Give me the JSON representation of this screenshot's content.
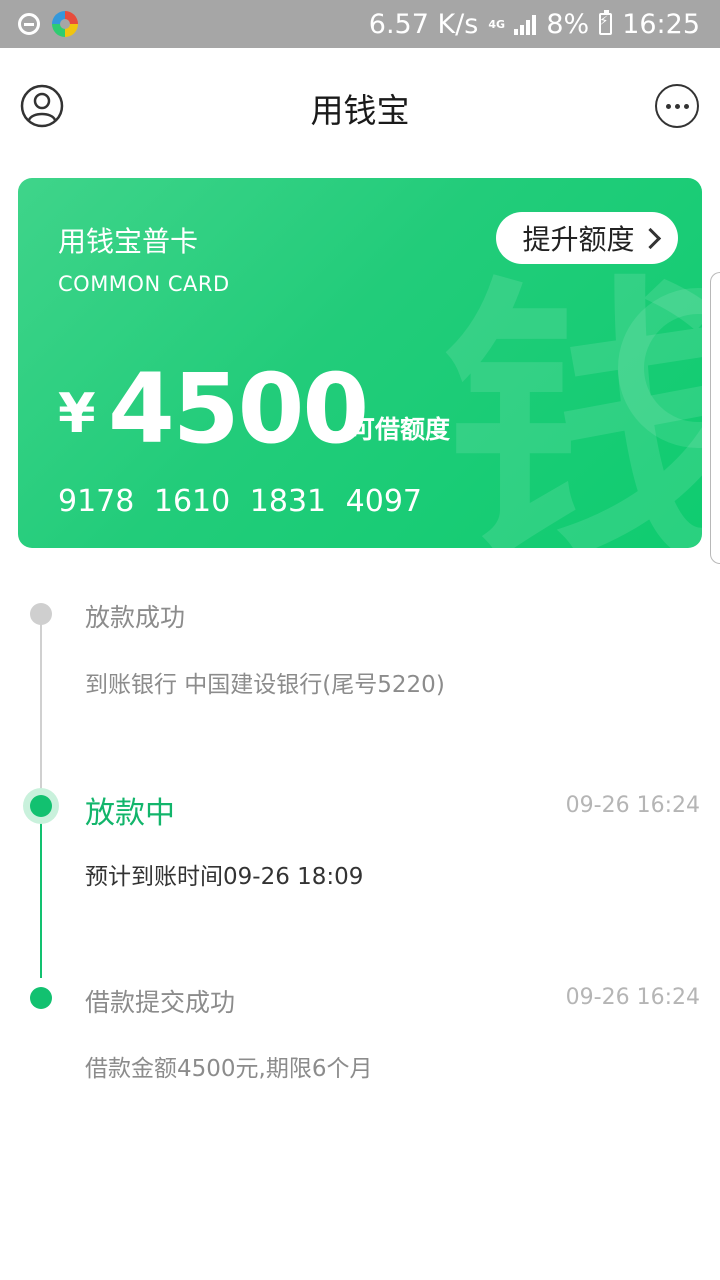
{
  "status_bar": {
    "speed": "6.57 K/s",
    "network": "4G",
    "battery": "8%",
    "time": "16:25",
    "icons": [
      "do-not-disturb-icon",
      "app-360-icon",
      "signal-icon",
      "battery-charging-icon"
    ]
  },
  "header": {
    "title": "用钱宝",
    "left_icon": "user-avatar-icon",
    "right_icon": "more-options-icon"
  },
  "card": {
    "name": "用钱宝普卡",
    "subtitle": "COMMON CARD",
    "raise_button": "提升额度",
    "currency": "¥",
    "amount": "4500",
    "amount_label": "可借额度",
    "number": "9178  1610  1831  4097",
    "watermark": "钱",
    "colors": {
      "card_start": "#3fd48a",
      "card_end": "#0fcc70"
    }
  },
  "timeline": {
    "accent_color": "#12c170",
    "steps": [
      {
        "title": "放款成功",
        "detail": "到账银行 中国建设银行(尾号5220)",
        "time": "",
        "state": "pending"
      },
      {
        "title": "放款中",
        "detail": "预计到账时间09-26 18:09",
        "time": "09-26 16:24",
        "state": "active"
      },
      {
        "title": "借款提交成功",
        "detail": "借款金额4500元,期限6个月",
        "time": "09-26 16:24",
        "state": "done"
      }
    ]
  }
}
